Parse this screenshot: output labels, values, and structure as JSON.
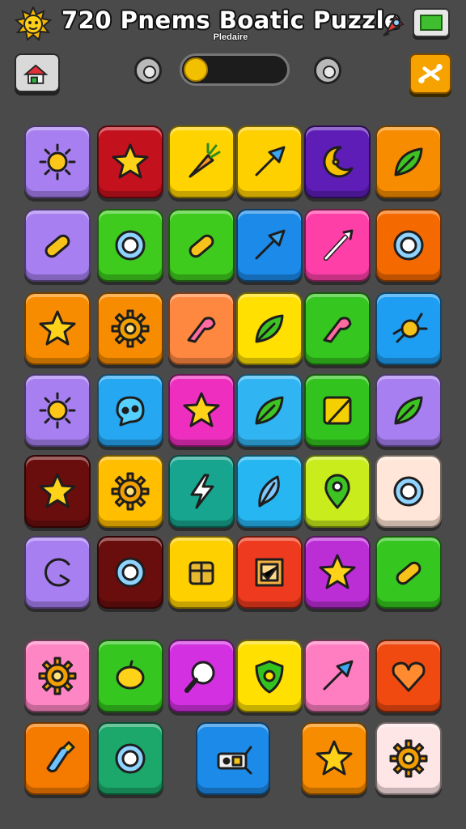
{
  "header": {
    "title": "720 Pnems  Boatic  Puzzle",
    "subtitle": "Pledaire"
  },
  "icons": {
    "logo": "sun-icon",
    "rocket": "rocket-icon",
    "screen": "screen-icon",
    "home": "home-icon",
    "left_control": "ring-icon",
    "right_control": "ring-icon",
    "shuffle": "shuffle-icon"
  },
  "progress": {
    "fraction": 0.12
  },
  "colors": {
    "background": "#4a4a4a",
    "accent": "#f6a300",
    "progress": "#f3c000"
  },
  "grid": {
    "rows": [
      [
        {
          "color": "#a77ff0",
          "icon": "sun"
        },
        {
          "color": "#c4111e",
          "icon": "star"
        },
        {
          "color": "#ffd300",
          "icon": "carrot"
        },
        {
          "color": "#ffd000",
          "icon": "arrow"
        },
        {
          "color": "#5d1db6",
          "icon": "moon"
        },
        {
          "color": "#f78c00",
          "icon": "leaf"
        }
      ],
      [
        {
          "color": "#a77ff0",
          "icon": "pill"
        },
        {
          "color": "#3ecb1e",
          "icon": "ring"
        },
        {
          "color": "#3ecb1e",
          "icon": "pill"
        },
        {
          "color": "#1c8ae8",
          "icon": "arrow"
        },
        {
          "color": "#ff3fa8",
          "icon": "wand"
        },
        {
          "color": "#f56a00",
          "icon": "ring"
        }
      ],
      [
        {
          "color": "#f78c00",
          "icon": "star"
        },
        {
          "color": "#f78c00",
          "icon": "gear"
        },
        {
          "color": "#ff8840",
          "icon": "hook"
        },
        {
          "color": "#ffe000",
          "icon": "leaf"
        },
        {
          "color": "#35c61f",
          "icon": "hook"
        },
        {
          "color": "#1e9ef2",
          "icon": "bug"
        }
      ],
      [
        {
          "color": "#a77ff0",
          "icon": "sun"
        },
        {
          "color": "#26a7f2",
          "icon": "bubble"
        },
        {
          "color": "#ee2ebe",
          "icon": "star"
        },
        {
          "color": "#31b5f2",
          "icon": "leaf"
        },
        {
          "color": "#33c31e",
          "icon": "square"
        },
        {
          "color": "#a77ff0",
          "icon": "leaf"
        }
      ],
      [
        {
          "color": "#6a0d0d",
          "icon": "star"
        },
        {
          "color": "#ffbe00",
          "icon": "gear"
        },
        {
          "color": "#17a58f",
          "icon": "bolt"
        },
        {
          "color": "#26b7f2",
          "icon": "feather"
        },
        {
          "color": "#c8ec1c",
          "icon": "pin"
        },
        {
          "color": "#ffe6d8",
          "icon": "ring"
        }
      ],
      [
        {
          "color": "#a77ff0",
          "icon": "swirl"
        },
        {
          "color": "#6a0d0d",
          "icon": "ring"
        },
        {
          "color": "#ffd000",
          "icon": "box"
        },
        {
          "color": "#ee3a1e",
          "icon": "frame"
        },
        {
          "color": "#bb2ed6",
          "icon": "star"
        },
        {
          "color": "#35c61f",
          "icon": "pill"
        }
      ],
      [
        {
          "color": "#ff86c4",
          "icon": "gear"
        },
        {
          "color": "#35c61f",
          "icon": "lemon"
        },
        {
          "color": "#d230e0",
          "icon": "magnifier"
        },
        {
          "color": "#ffe000",
          "icon": "shield"
        },
        {
          "color": "#ff7ec2",
          "icon": "arrow"
        },
        {
          "color": "#f04a10",
          "icon": "heart"
        }
      ],
      [
        {
          "color": "#f57a00",
          "icon": "bottle"
        },
        {
          "color": "#1ca86a",
          "icon": "ring"
        },
        null,
        {
          "color": "#1c8ae8",
          "icon": "machine"
        },
        {
          "color": "#f78c00",
          "icon": "star"
        },
        {
          "color": "#ffe6e6",
          "icon": "gear"
        }
      ]
    ]
  }
}
